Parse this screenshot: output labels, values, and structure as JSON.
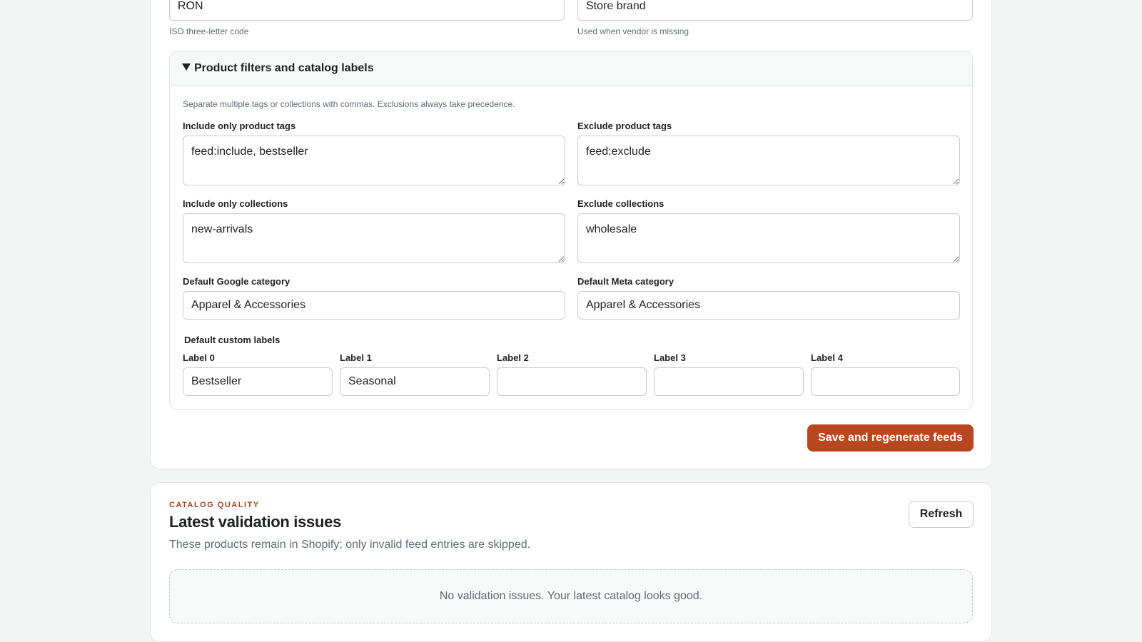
{
  "feed_settings": {
    "currency": {
      "value": "RON",
      "hint": "ISO three-letter code"
    },
    "brand": {
      "value": "Store brand",
      "hint": "Used when vendor is missing"
    }
  },
  "filters": {
    "title": "Product filters and catalog labels",
    "help": "Separate multiple tags or collections with commas. Exclusions always take precedence.",
    "include_tags": {
      "label": "Include only product tags",
      "value": "feed:include, bestseller"
    },
    "exclude_tags": {
      "label": "Exclude product tags",
      "value": "feed:exclude"
    },
    "include_collections": {
      "label": "Include only collections",
      "value": "new-arrivals"
    },
    "exclude_collections": {
      "label": "Exclude collections",
      "value": "wholesale"
    },
    "google_category": {
      "label": "Default Google category",
      "value": "Apparel & Accessories"
    },
    "meta_category": {
      "label": "Default Meta category",
      "value": "Apparel & Accessories"
    },
    "custom_labels": {
      "title": "Default custom labels",
      "items": [
        {
          "label": "Label 0",
          "value": "Bestseller"
        },
        {
          "label": "Label 1",
          "value": "Seasonal"
        },
        {
          "label": "Label 2",
          "value": ""
        },
        {
          "label": "Label 3",
          "value": ""
        },
        {
          "label": "Label 4",
          "value": ""
        }
      ]
    }
  },
  "actions": {
    "save_label": "Save and regenerate feeds"
  },
  "catalog_quality": {
    "eyebrow": "CATALOG QUALITY",
    "title": "Latest validation issues",
    "description": "These products remain in Shopify; only invalid feed entries are skipped.",
    "refresh_label": "Refresh",
    "empty_message": "No validation issues. Your latest catalog looks good."
  },
  "colors": {
    "accent": "#b8471f",
    "eyebrow": "#a8451f",
    "muted_text": "#616a75",
    "border": "#c9cccf"
  }
}
